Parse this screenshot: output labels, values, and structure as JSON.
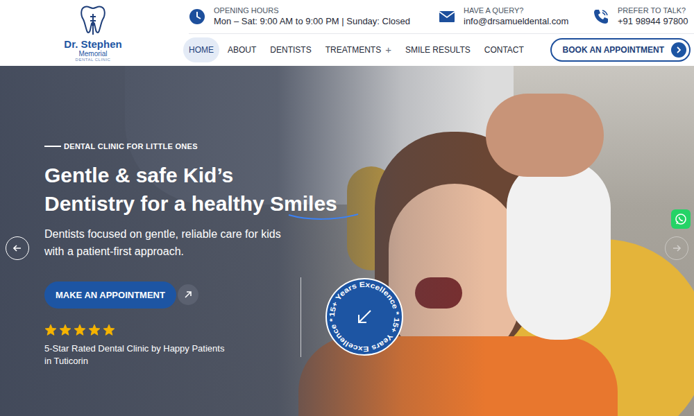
{
  "logo": {
    "line1": "Dr. Stephen",
    "line2": "Memorial",
    "line3": "DENTAL CLINIC"
  },
  "contacts": [
    {
      "kind": "hours",
      "label": "OPENING HOURS",
      "value": "Mon – Sat: 9:00 AM to 9:00 PM | Sunday: Closed"
    },
    {
      "kind": "email",
      "label": "HAVE A QUERY?",
      "value": "info@drsamueldental.com"
    },
    {
      "kind": "phone",
      "label": "PREFER TO TALK?",
      "value": "+91 98944 97800"
    }
  ],
  "nav": [
    {
      "label": "HOME",
      "selected": true
    },
    {
      "label": "ABOUT",
      "selected": false
    },
    {
      "label": "DENTISTS",
      "selected": false
    },
    {
      "label": "TREATMENTS",
      "selected": false,
      "toggle": "+"
    },
    {
      "label": "SMILE RESULTS",
      "selected": false
    },
    {
      "label": "CONTACT",
      "selected": false
    }
  ],
  "book_button": "BOOK AN APPOINTMENT",
  "hero": {
    "eyebrow": "DENTAL CLINIC FOR LITTLE ONES",
    "title_lines": [
      "Gentle & safe Kid’s",
      "Dentistry for a healthy Smiles"
    ],
    "text_lines": [
      "Dentists focused on gentle, reliable care for kids",
      "with a patient-first approach."
    ],
    "cta": "MAKE AN APPOINTMENT",
    "stars": 5,
    "rating_lines": [
      "5-Star Rated Dental Clinic by Happy Patients",
      "in Tuticorin"
    ],
    "badge": "15+ Years Excellence * 15+ Years Excellence *"
  }
}
